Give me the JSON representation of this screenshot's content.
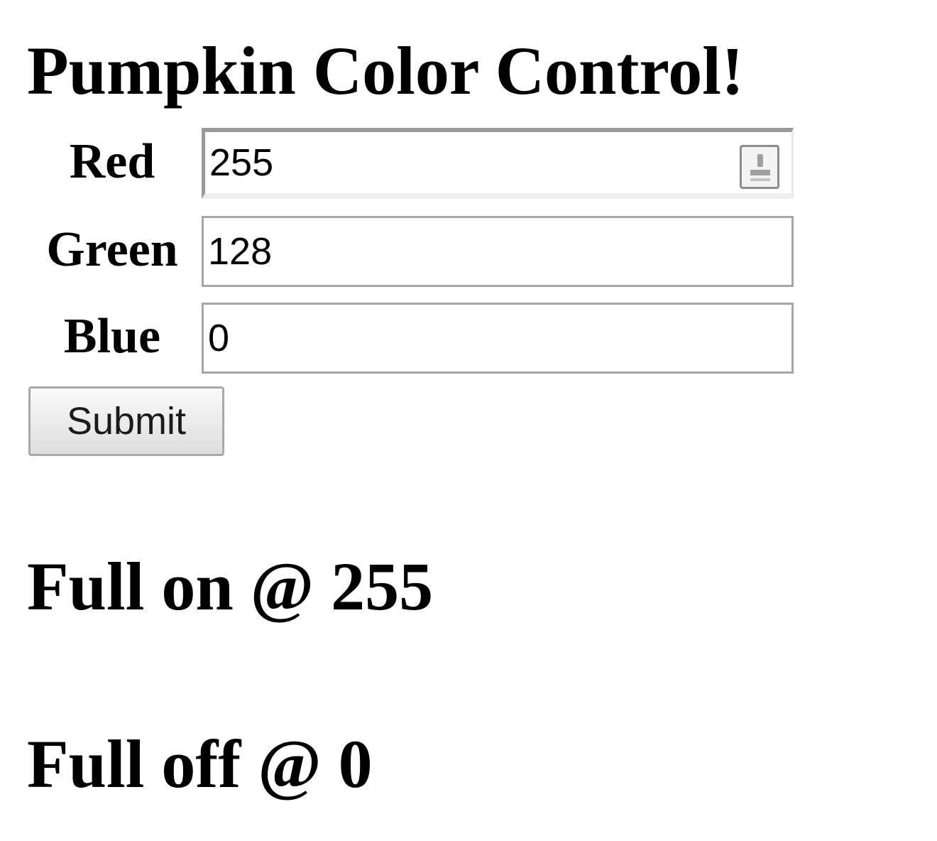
{
  "page": {
    "title": "Pumpkin Color Control!"
  },
  "form": {
    "red": {
      "label": "Red",
      "value": "255"
    },
    "green": {
      "label": "Green",
      "value": "128"
    },
    "blue": {
      "label": "Blue",
      "value": "0"
    },
    "submit_label": "Submit"
  },
  "info": {
    "full_on": "Full on @ 255",
    "full_off": "Full off @ 0"
  },
  "icons": {
    "red_field_autofill": "autofill-icon"
  }
}
